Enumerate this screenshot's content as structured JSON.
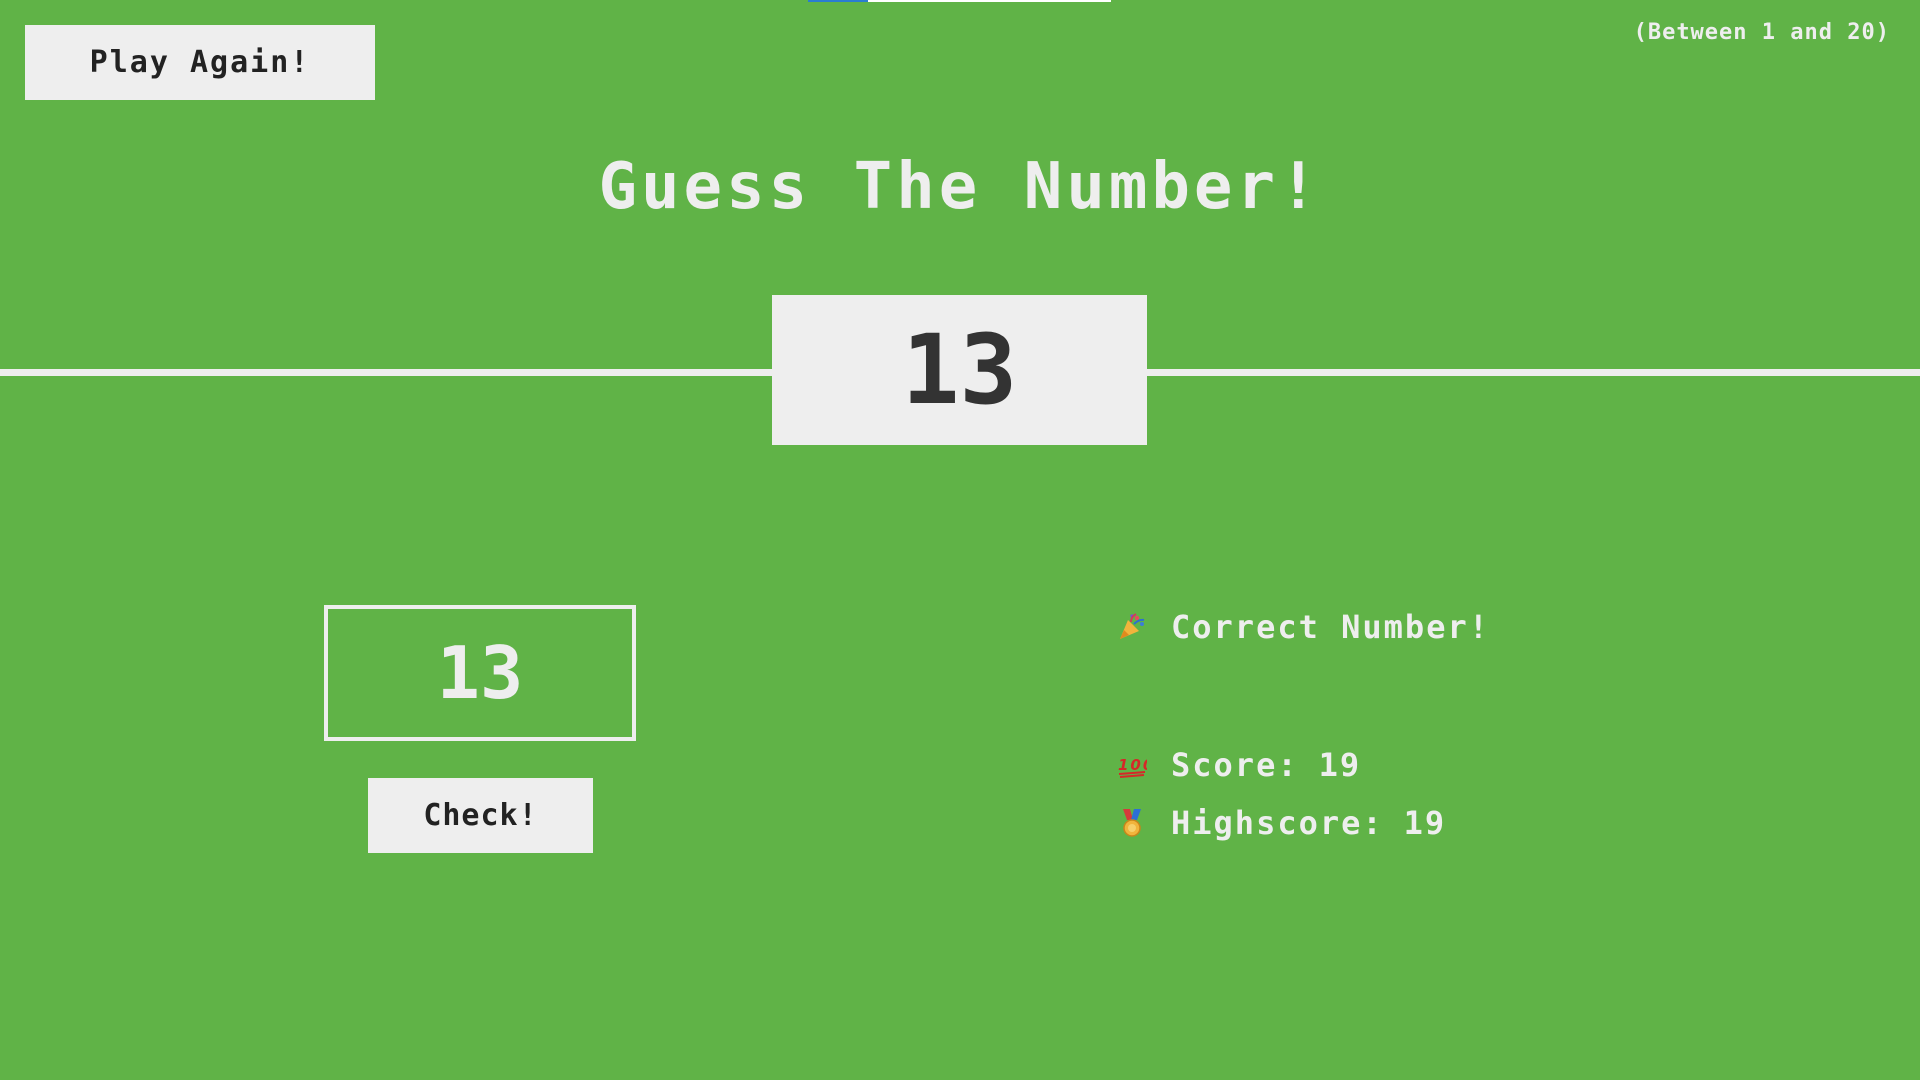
{
  "header": {
    "play_again_label": "Play Again!",
    "range_hint": "(Between 1 and 20)",
    "title": "Guess The Number!"
  },
  "secret_number": "13",
  "guess": {
    "value": "13",
    "check_label": "Check!"
  },
  "status": {
    "message": "Correct Number!",
    "message_icon": "party-popper-icon",
    "score_label": "Score:",
    "score_value": "19",
    "score_icon": "hundred-points-icon",
    "highscore_label": "Highscore:",
    "highscore_value": "19",
    "highscore_icon": "medal-icon"
  },
  "colors": {
    "background": "#60b347",
    "foreground": "#eeeeee",
    "dark_text": "#333333"
  }
}
